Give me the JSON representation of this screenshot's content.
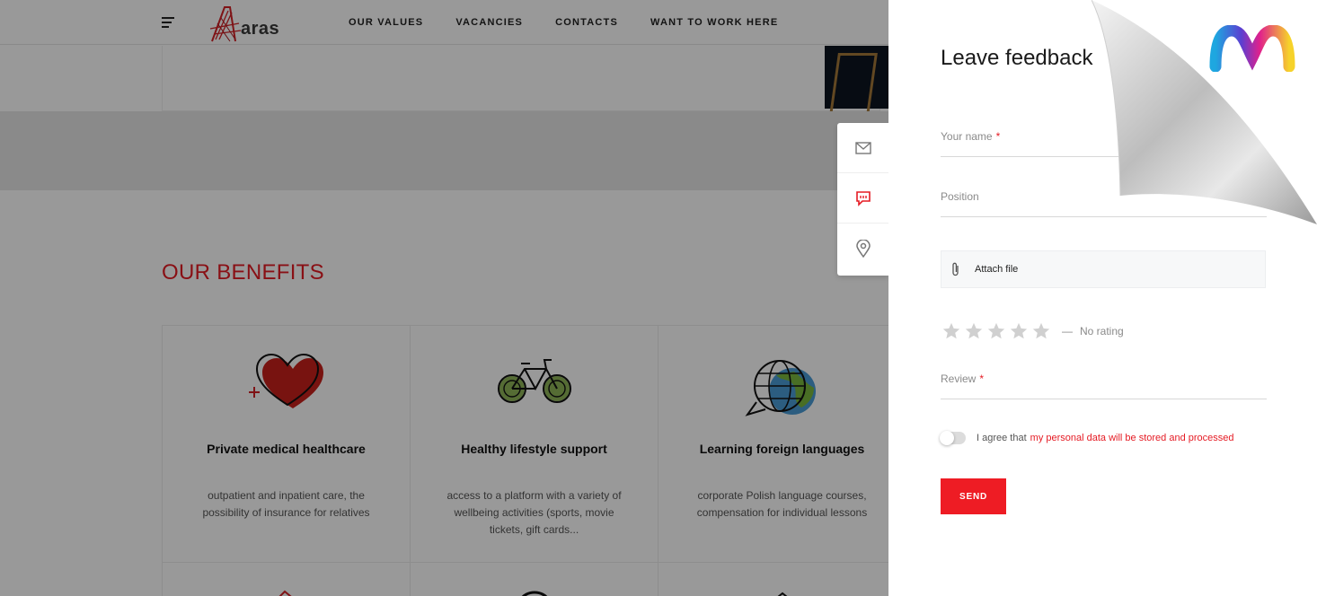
{
  "nav": {
    "logo_text": "aras",
    "links": [
      "OUR VALUES",
      "VACANCIES",
      "CONTACTS",
      "WANT TO WORK HERE"
    ]
  },
  "benefits_section": {
    "title": "OUR BENEFITS",
    "items": [
      {
        "title": "Private medical healthcare",
        "desc": "outpatient and inpatient care, the possibility of insurance for relatives",
        "icon": "heart-icon"
      },
      {
        "title": "Healthy lifestyle support",
        "desc": "access to a platform with a variety of wellbeing activities (sports, movie tickets, gift cards...",
        "icon": "bicycle-icon"
      },
      {
        "title": "Learning foreign languages",
        "desc": "corporate Polish language courses, compensation for individual lessons",
        "icon": "globe-chat-icon"
      }
    ]
  },
  "side_widget": {
    "icons": [
      "mail-icon",
      "chat-icon",
      "location-icon"
    ],
    "accent": "#e51b24"
  },
  "feedback": {
    "title": "Leave feedback",
    "name_label": "Your name",
    "required_mark": "*",
    "position_label": "Position",
    "attach_label": "Attach file",
    "rating_dash": "—",
    "rating_text": "No rating",
    "review_label": "Review",
    "agree_prefix": "I agree that",
    "agree_link": "my personal data will be stored and processed",
    "send_label": "SEND",
    "star_count": 5,
    "rating_value": 0
  },
  "colors": {
    "accent_red": "#e51b24",
    "button_red": "#ee1c24"
  }
}
